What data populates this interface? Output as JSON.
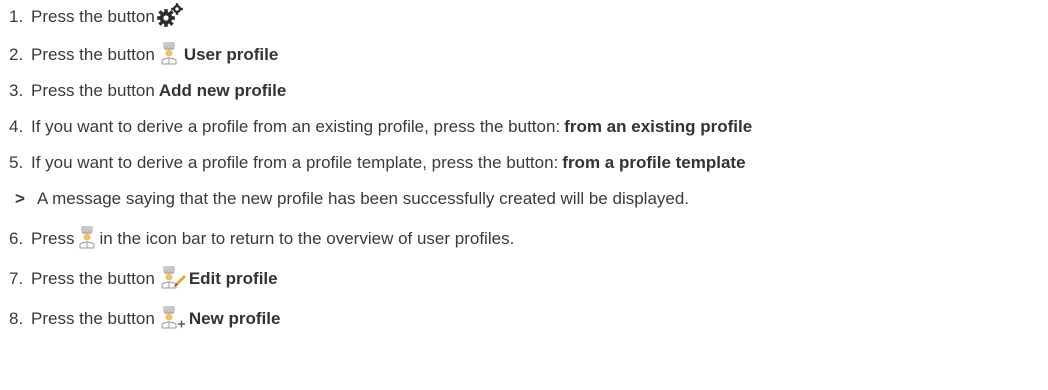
{
  "steps": [
    {
      "num": "1.",
      "text": "Press the button ",
      "icon": "gears-icon",
      "bold": ""
    },
    {
      "num": "2.",
      "text": "Press the button ",
      "icon": "chef-user-icon",
      "bold": "User profile"
    },
    {
      "num": "3.",
      "text": "Press the button ",
      "icon": "",
      "bold": "Add new profile"
    },
    {
      "num": "4.",
      "text": "If you want to derive a profile from an existing profile, press the button: ",
      "icon": "",
      "bold": "from an existing profile"
    },
    {
      "num": "5.",
      "text": "If you want to derive a profile from a profile template, press the button: ",
      "icon": "",
      "bold": "from a profile template"
    },
    {
      "num": ">",
      "text": "A message saying that the new profile has been successfully created will be displayed.",
      "icon": "",
      "bold": ""
    },
    {
      "num": "6.",
      "pre": "Press ",
      "icon": "chef-user-icon",
      "text": " in the icon bar to return to the overview of user profiles.",
      "bold": ""
    },
    {
      "num": "7.",
      "text": "Press the button ",
      "icon": "chef-edit-icon",
      "bold": "Edit profile"
    },
    {
      "num": "8.",
      "text": "Press the button ",
      "icon": "chef-add-icon",
      "bold": "New profile"
    }
  ],
  "colors": {
    "text": "#3a3a3a",
    "chef_hat": "#c8c8c8",
    "chef_face": "#f0c36b",
    "edit_pencil": "#e6a23c",
    "gear": "#2b2b2b"
  }
}
